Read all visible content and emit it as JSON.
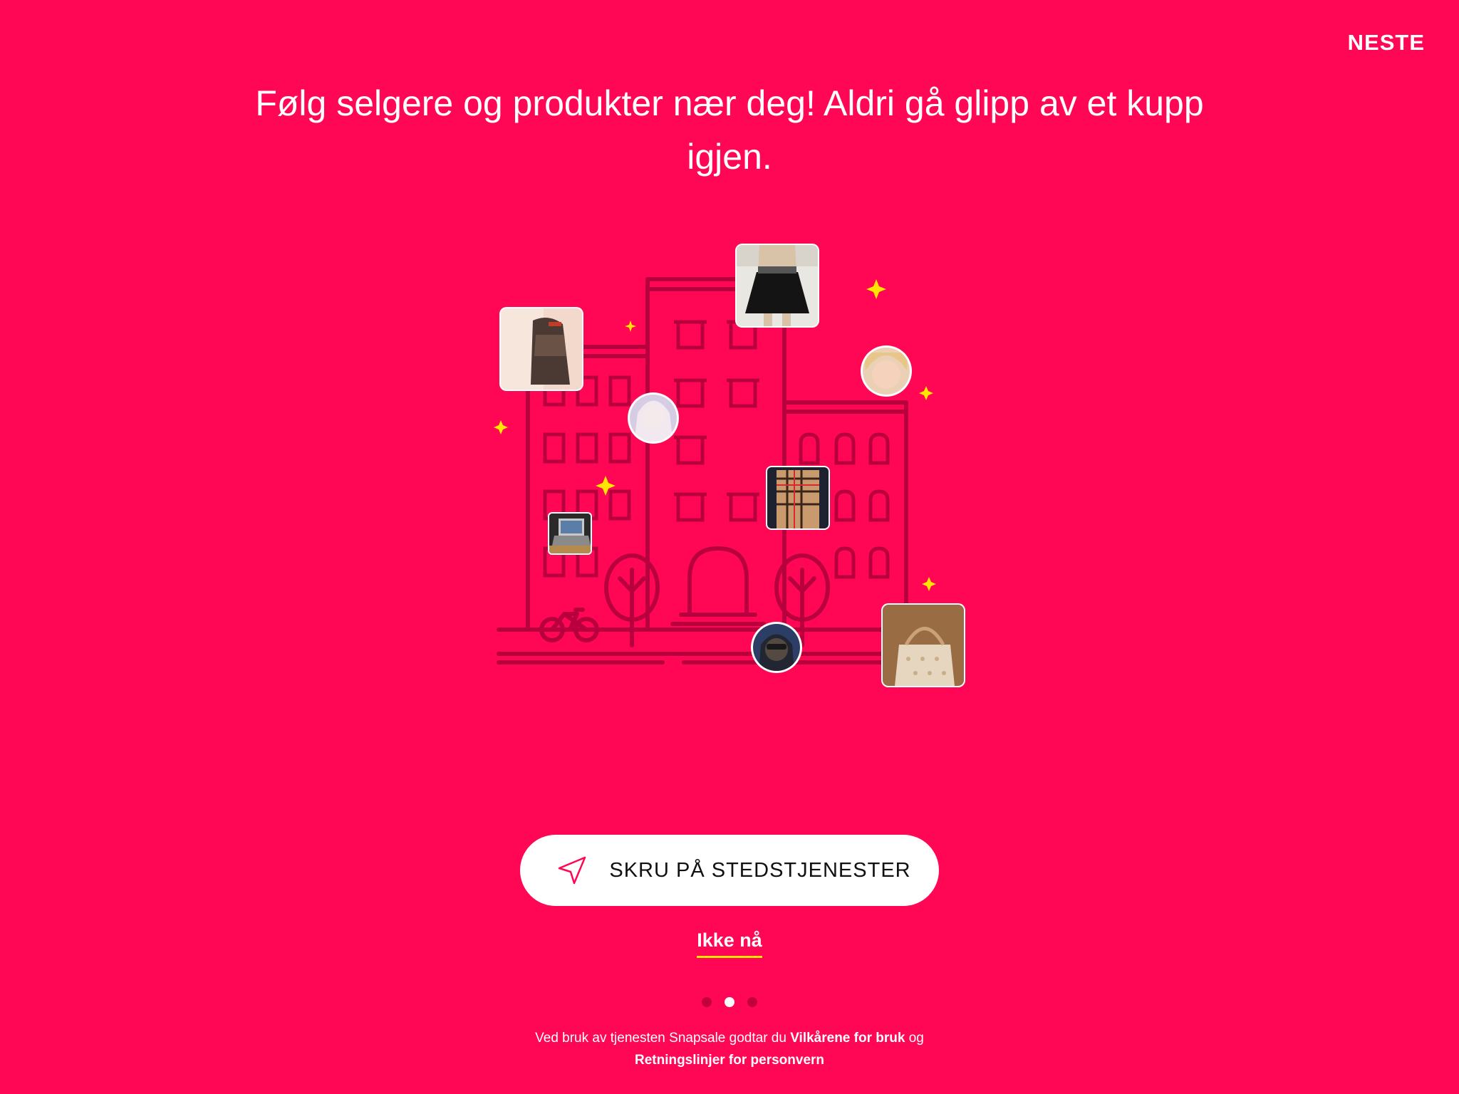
{
  "header": {
    "next_label": "NESTE"
  },
  "headline": "Følg selgere og produkter nær deg! Aldri gå glipp av et kupp igjen.",
  "cta": {
    "label": "SKRU PÅ STEDSTJENESTER",
    "icon": "location-arrow-icon"
  },
  "secondary": {
    "label": "Ikke nå"
  },
  "pager": {
    "total": 3,
    "active_index": 2
  },
  "footer": {
    "prefix": "Ved bruk av tjenesten Snapsale godtar du ",
    "terms_link": "Vilkårene for bruk",
    "middle": " og ",
    "privacy_link": "Retningslinjer for personvern"
  },
  "colors": {
    "background": "#ff0755",
    "accent_underline": "#ffe600",
    "sparkle": "#ffe600",
    "illustration_line": "#b8003f"
  }
}
